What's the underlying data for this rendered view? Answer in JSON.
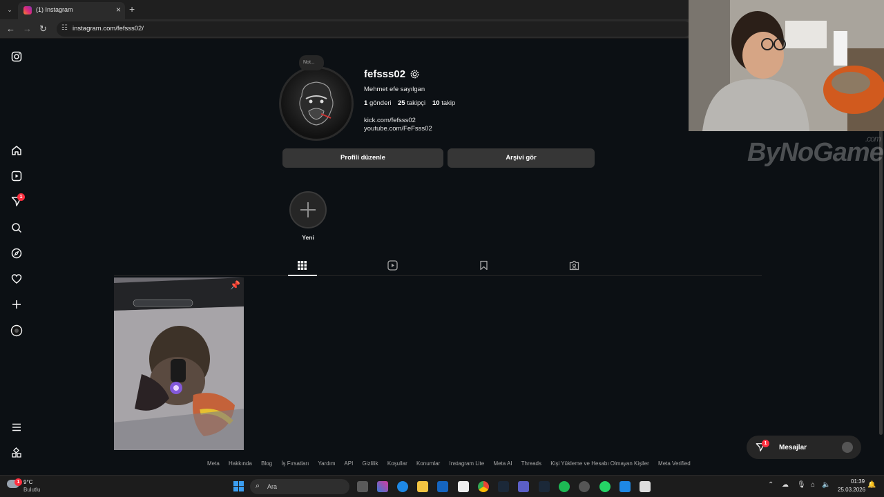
{
  "browser": {
    "tab_title": "(1) Instagram",
    "url": "instagram.com/fefsss02/"
  },
  "nav": {
    "notifications_badge": "1",
    "items": [
      "instagram-logo-icon",
      "home-icon",
      "reels-icon",
      "messages-icon",
      "search-icon",
      "explore-icon",
      "notifications-icon",
      "create-icon",
      "profile-icon",
      "menu-icon",
      "meta-apps-icon"
    ]
  },
  "profile": {
    "note_label": "Not...",
    "username": "fefsss02",
    "full_name": "Mehmet efe sayılgan",
    "posts_count": "1",
    "posts_label": "gönderi",
    "followers_count": "25",
    "followers_label": "takipçi",
    "following_count": "10",
    "following_label": "takip",
    "links": [
      "kick.com/fefsss02",
      "youtube.com/FeFsss02"
    ],
    "edit_button": "Profili düzenle",
    "archive_button": "Arşivi gör",
    "new_highlight_label": "Yeni"
  },
  "footer": {
    "links": [
      "Meta",
      "Hakkında",
      "Blog",
      "İş Fırsatları",
      "Yardım",
      "API",
      "Gizlilik",
      "Koşullar",
      "Konumlar",
      "Instagram Lite",
      "Meta AI",
      "Threads",
      "Kişi Yükleme ve Hesabı Olmayan Kişiler",
      "Meta Verified"
    ]
  },
  "messages": {
    "label": "Mesajlar",
    "badge": "1"
  },
  "watermark": {
    "brand": "ByNoGame",
    "suffix": ".com"
  },
  "taskbar": {
    "weather_temp": "9°C",
    "weather_desc": "Bulutlu",
    "weather_badge": "1",
    "search_label": "Ara",
    "time": "01:39",
    "date": "25.03.2026"
  },
  "colors": {
    "background": "#0c1014",
    "badge": "#ff3040",
    "button": "#363636"
  }
}
